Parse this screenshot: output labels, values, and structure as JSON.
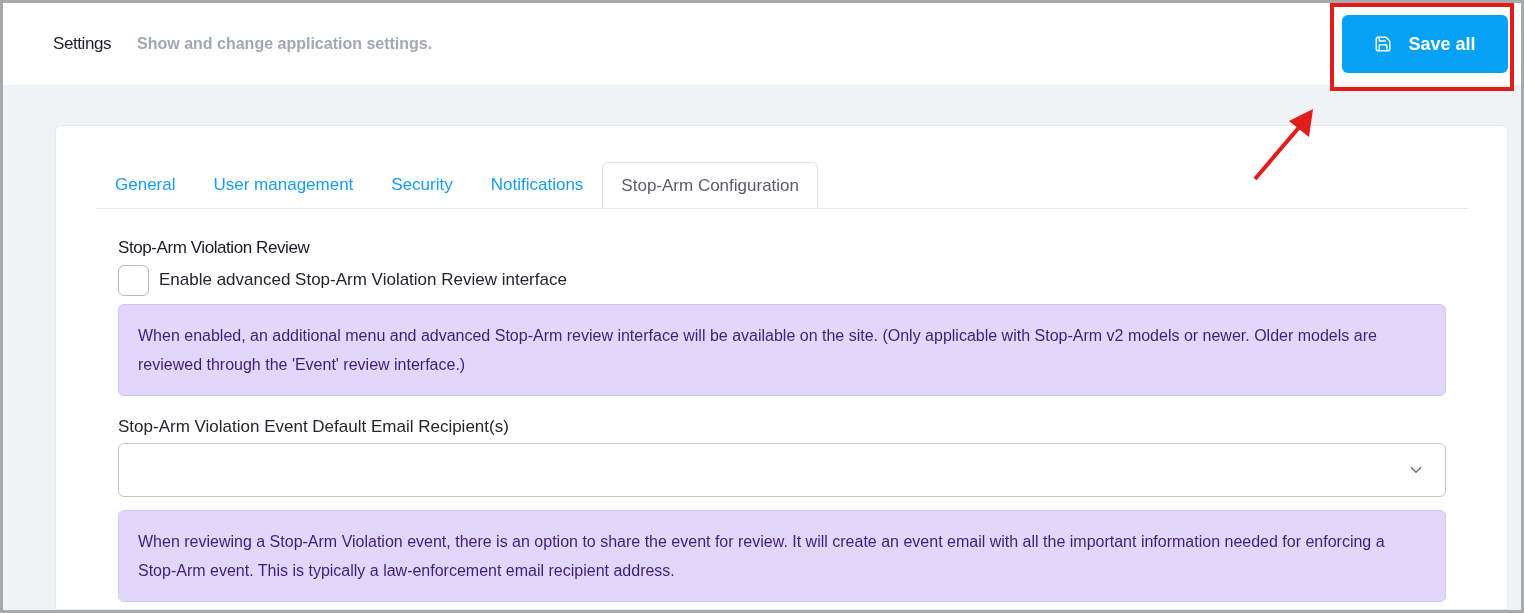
{
  "header": {
    "title": "Settings",
    "subtitle": "Show and change application settings.",
    "save_button": "Save all"
  },
  "tabs": [
    {
      "label": "General",
      "selected": false
    },
    {
      "label": "User management",
      "selected": false
    },
    {
      "label": "Security",
      "selected": false
    },
    {
      "label": "Notifications",
      "selected": false
    },
    {
      "label": "Stop-Arm Configuration",
      "selected": true
    }
  ],
  "section": {
    "title": "Stop-Arm Violation Review",
    "checkbox": {
      "label": "Enable advanced Stop-Arm Violation Review interface",
      "checked": false
    },
    "info": "When enabled, an additional menu and advanced Stop-Arm review interface will be available on the site. (Only applicable with Stop-Arm v2 models or newer. Older models are reviewed through the 'Event' review interface.)"
  },
  "recipients": {
    "label": "Stop-Arm Violation Event Default Email Recipient(s)",
    "info": "When reviewing a Stop-Arm Violation event, there is an option to share the event for review. It will create an event email with all the important information needed for enforcing a Stop-Arm event. This is typically a law-enforcement email recipient address."
  }
}
